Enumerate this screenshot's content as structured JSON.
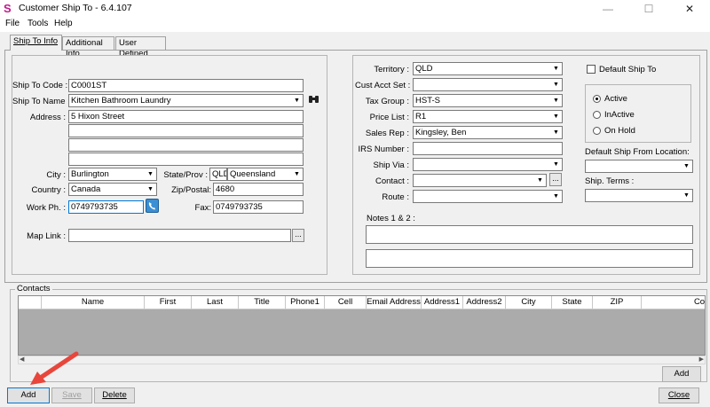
{
  "window": {
    "title": "Customer Ship To - 6.4.107",
    "logo": "S",
    "minimize": "—",
    "maximize": "☐",
    "close": "✕"
  },
  "menu": {
    "file": "File",
    "tools": "Tools",
    "help": "Help"
  },
  "tabs": {
    "ship_to_info": "Ship To Info",
    "additional_info": "Additional Info",
    "user_defined": "User Defined"
  },
  "left": {
    "ship_to_code_label": "Ship To Code :",
    "ship_to_code": "C0001ST",
    "ship_to_name_label": "Ship To Name :",
    "ship_to_name": "Kitchen Bathroom Laundry",
    "address_label": "Address :",
    "address_line1": "5 Hixon Street",
    "address_line2": "",
    "address_line3": "",
    "address_line4": "",
    "city_label": "City :",
    "city": "Burlington",
    "state_label": "State/Prov :",
    "state_code": "QLD",
    "state_name": "Queensland",
    "country_label": "Country :",
    "country": "Canada",
    "zip_label": "Zip/Postal:",
    "zip": "4680",
    "work_ph_label": "Work Ph. :",
    "work_ph": "0749793735",
    "fax_label": "Fax:",
    "fax": "0749793735",
    "map_link_label": "Map Link :",
    "map_link": "",
    "ellipsis": "..."
  },
  "middle": {
    "territory_label": "Territory :",
    "territory": "QLD",
    "cust_acct_set_label": "Cust Acct Set :",
    "cust_acct_set": "",
    "tax_group_label": "Tax Group :",
    "tax_group": "HST-S",
    "price_list_label": "Price List :",
    "price_list": "R1",
    "sales_rep_label": "Sales Rep :",
    "sales_rep": "Kingsley, Ben",
    "irs_number_label": "IRS Number :",
    "irs_number": "",
    "ship_via_label": "Ship Via :",
    "ship_via": "",
    "contact_label": "Contact :",
    "contact": "",
    "route_label": "Route :",
    "route": "",
    "notes_label": "Notes 1 & 2 :",
    "notes1": "",
    "notes2": "",
    "ellipsis": "..."
  },
  "right": {
    "default_ship_to_label": "Default Ship To",
    "active_label": "Active",
    "inactive_label": "InActive",
    "on_hold_label": "On Hold",
    "default_ship_from_label": "Default Ship From Location:",
    "default_ship_from": "",
    "ship_terms_label": "Ship. Terms :",
    "ship_terms": ""
  },
  "contacts": {
    "group_label": "Contacts",
    "columns": [
      "Name",
      "First",
      "Last",
      "Title",
      "Phone1",
      "Cell",
      "Email Address",
      "Address1",
      "Address2",
      "City",
      "State",
      "ZIP",
      "Com"
    ],
    "add_label": "Add"
  },
  "buttons": {
    "add": "Add",
    "save": "Save",
    "delete": "Delete",
    "close": "Close"
  },
  "colors": {
    "accent": "#0078d7",
    "arrow": "#e8463c",
    "logo": "#c0198a"
  }
}
